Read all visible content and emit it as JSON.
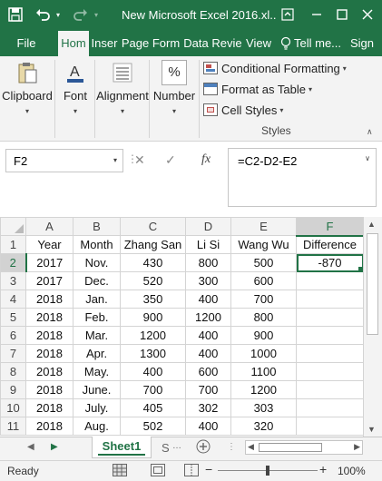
{
  "window": {
    "title": "New Microsoft Excel 2016.xl..."
  },
  "ribbon_tabs": [
    {
      "label": "File"
    },
    {
      "label": "Hom"
    },
    {
      "label": "Inser"
    },
    {
      "label": "Page"
    },
    {
      "label": "Form"
    },
    {
      "label": "Data"
    },
    {
      "label": "Revie"
    },
    {
      "label": "View"
    },
    {
      "label": "Tell me..."
    },
    {
      "label": "Sign"
    }
  ],
  "ribbon": {
    "clipboard": "Clipboard",
    "font": "Font",
    "alignment": "Alignment",
    "number": "Number",
    "number_icon": "%",
    "conditional_formatting": "Conditional Formatting",
    "format_as_table": "Format as Table",
    "cell_styles": "Cell Styles",
    "styles_group": "Styles"
  },
  "formula_bar": {
    "name_box": "F2",
    "fx": "fx",
    "formula": "=C2-D2-E2"
  },
  "columns": [
    "A",
    "B",
    "C",
    "D",
    "E",
    "F"
  ],
  "row_numbers": [
    "1",
    "2",
    "3",
    "4",
    "5",
    "6",
    "7",
    "8",
    "9",
    "10",
    "11"
  ],
  "rows": [
    [
      "Year",
      "Month",
      "Zhang San",
      "Li Si",
      "Wang Wu",
      "Difference"
    ],
    [
      "2017",
      "Nov.",
      "430",
      "800",
      "500",
      "-870"
    ],
    [
      "2017",
      "Dec.",
      "520",
      "300",
      "600",
      ""
    ],
    [
      "2018",
      "Jan.",
      "350",
      "400",
      "700",
      ""
    ],
    [
      "2018",
      "Feb.",
      "900",
      "1200",
      "800",
      ""
    ],
    [
      "2018",
      "Mar.",
      "1200",
      "400",
      "900",
      ""
    ],
    [
      "2018",
      "Apr.",
      "1300",
      "400",
      "1000",
      ""
    ],
    [
      "2018",
      "May.",
      "400",
      "600",
      "1100",
      ""
    ],
    [
      "2018",
      "June.",
      "700",
      "700",
      "1200",
      ""
    ],
    [
      "2018",
      "July.",
      "405",
      "302",
      "303",
      ""
    ],
    [
      "2018",
      "Aug.",
      "502",
      "400",
      "320",
      ""
    ]
  ],
  "selected": {
    "column": "F",
    "row": "2"
  },
  "sheets": {
    "active": "Sheet1",
    "next_partial": "S"
  },
  "status": {
    "ready": "Ready",
    "zoom": "100%"
  },
  "colors": {
    "excel_green": "#217346",
    "ribbon_bg": "#f3f3f3",
    "grid_line": "#d4d4d4"
  }
}
